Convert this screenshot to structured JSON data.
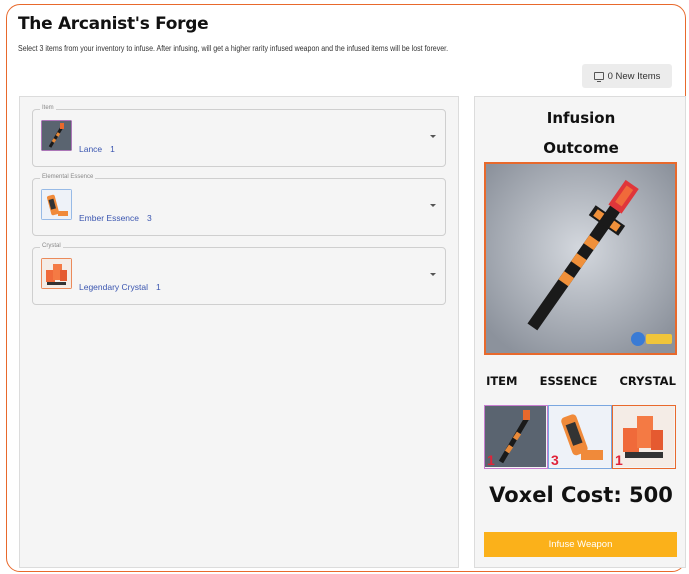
{
  "header": {
    "title": "The Arcanist's Forge",
    "subtitle": "Select 3 items from your inventory to infuse. After infusing, will get a higher rarity infused weapon and the infused items will be lost forever.",
    "new_items_label": "0 New Items"
  },
  "fields": [
    {
      "legend": "Item",
      "label": "Lance",
      "qty": "1",
      "icon": "lance-icon"
    },
    {
      "legend": "Elemental Essence",
      "label": "Ember Essence",
      "qty": "3",
      "icon": "ember-essence-icon"
    },
    {
      "legend": "Crystal",
      "label": "Legendary Crystal",
      "qty": "1",
      "icon": "legendary-crystal-icon"
    }
  ],
  "outcome": {
    "title_line1": "Infusion",
    "title_line2": "Outcome",
    "slot_labels": [
      "ITEM",
      "ESSENCE",
      "CRYSTAL"
    ],
    "slot_counts": [
      "1",
      "3",
      "1"
    ],
    "voxel_cost": "Voxel Cost: 500",
    "infuse_label": "Infuse Weapon"
  },
  "colors": {
    "accent": "#e8692c",
    "button": "#fbb11a",
    "link": "#3b56b0",
    "count": "#e0243a"
  }
}
